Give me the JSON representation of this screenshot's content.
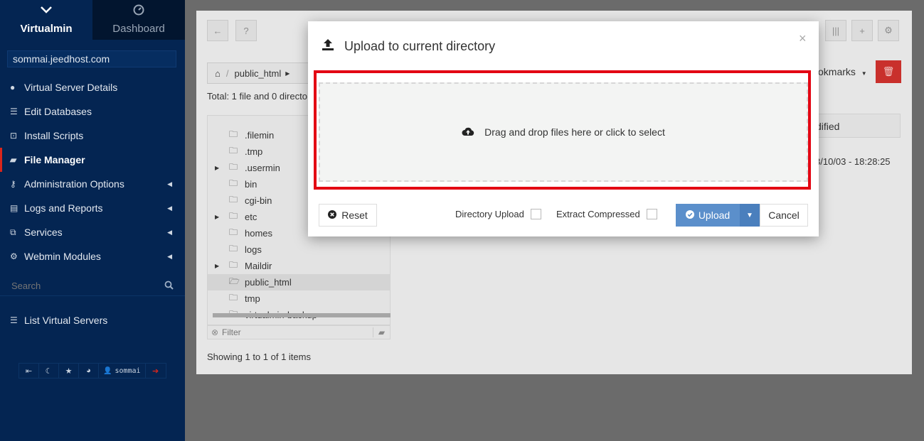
{
  "sidebar": {
    "tabs": [
      {
        "label": "Virtualmin",
        "icon": "chevron-down-icon"
      },
      {
        "label": "Dashboard",
        "icon": "dashboard-gauge-icon"
      }
    ],
    "host": "sommai.jeedhost.com",
    "items": [
      {
        "label": "Virtual Server Details",
        "icon": "info-circle-icon"
      },
      {
        "label": "Edit Databases",
        "icon": "database-icon"
      },
      {
        "label": "Install Scripts",
        "icon": "install-icon"
      },
      {
        "label": "File Manager",
        "icon": "folder-open-icon"
      },
      {
        "label": "Administration Options",
        "icon": "key-icon"
      },
      {
        "label": "Logs and Reports",
        "icon": "file-icon"
      },
      {
        "label": "Services",
        "icon": "sitemap-icon"
      },
      {
        "label": "Webmin Modules",
        "icon": "cogs-icon"
      }
    ],
    "search_placeholder": "Search",
    "list_virtual_servers": "List Virtual Servers",
    "user": "sommai"
  },
  "file_manager": {
    "breadcrumb": "public_html",
    "total_text": "Total: 1 file and 0 directo",
    "bookmarks": "okmarks",
    "tree": [
      {
        "name": ".filemin",
        "expandable": false
      },
      {
        "name": ".tmp",
        "expandable": false
      },
      {
        "name": ".usermin",
        "expandable": true
      },
      {
        "name": "bin",
        "expandable": false
      },
      {
        "name": "cgi-bin",
        "expandable": false
      },
      {
        "name": "etc",
        "expandable": true
      },
      {
        "name": "homes",
        "expandable": false
      },
      {
        "name": "logs",
        "expandable": false
      },
      {
        "name": "Maildir",
        "expandable": true
      },
      {
        "name": "public_html",
        "expandable": false,
        "selected": true
      },
      {
        "name": "tmp",
        "expandable": false
      },
      {
        "name": "virtualmin-backup",
        "expandable": false
      }
    ],
    "filter_placeholder": "Filter",
    "showing": "Showing 1 to 1 of 1 items",
    "table_header": "dified",
    "table_cell": "3/10/03 - 18:28:25"
  },
  "modal": {
    "title": "Upload to current directory",
    "close": "×",
    "dropzone_text": "Drag and drop files here or click to select",
    "reset_label": "Reset",
    "directory_upload_label": "Directory Upload",
    "extract_compressed_label": "Extract Compressed",
    "upload_label": "Upload",
    "cancel_label": "Cancel"
  },
  "colors": {
    "sidebar_bg": "#042552",
    "highlight_outline": "#e30613",
    "upload_button": "#5b8fcb",
    "delete_button": "#c9302c"
  }
}
